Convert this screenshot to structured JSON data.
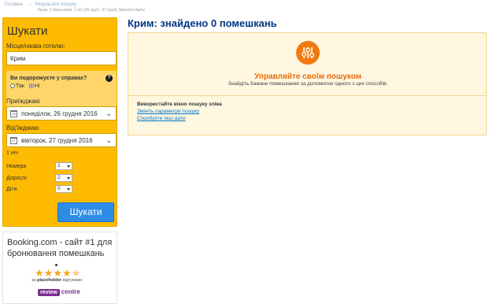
{
  "breadcrumb": {
    "home": "Головна",
    "current": "Результати пошуку",
    "details": "Крим, 1 дорослого, 1 ніч (26 груд - 27 груд)",
    "change": "Змінити дати"
  },
  "search": {
    "title": "Шукати",
    "destination_label": "Місце/назва готелю:",
    "destination_value": "Крим",
    "business_question": "Ви подорожуєте у справах?",
    "help_symbol": "?",
    "option_yes": "Так",
    "option_no": "Ні",
    "selected_option": "Ні",
    "checkin_label": "Приїжджаю",
    "checkin_value": "понеділок, 26 грудня 2016",
    "checkout_label": "Від'їжджаю",
    "checkout_value": "вівторок, 27 грудня 2016",
    "nights": "1 ніч",
    "rooms_label": "Номери",
    "rooms_value": "1",
    "adults_label": "Дорослі",
    "adults_value": "2",
    "children_label": "Діти",
    "children_value": "0",
    "submit_label": "Шукати",
    "accent_color": "#febb02",
    "button_color": "#2d8ce6"
  },
  "promo": {
    "headline": "Booking.com - сайт #1 для бронювання помешкань",
    "rating_stars": 4.5,
    "reviews_prefix": "за",
    "reviews_source": "placeholder",
    "reviews_suffix": "відгуками",
    "logo_review": "review",
    "logo_centre": "centre"
  },
  "main": {
    "title": "Крим: знайдено 0 помешкань",
    "notice_heading": "Управляйте своїм пошуком",
    "notice_sub": "Знайдіть бажане помешкання за допомогою одного з цих способів:",
    "option_title": "Використайте вікно пошуку зліва",
    "link_change_params": "Змініть параметри пошуку",
    "link_other_dates": "Спробуйте інші дати",
    "notice_icon": "sliders-icon",
    "heading_color": "#e86c0f"
  }
}
